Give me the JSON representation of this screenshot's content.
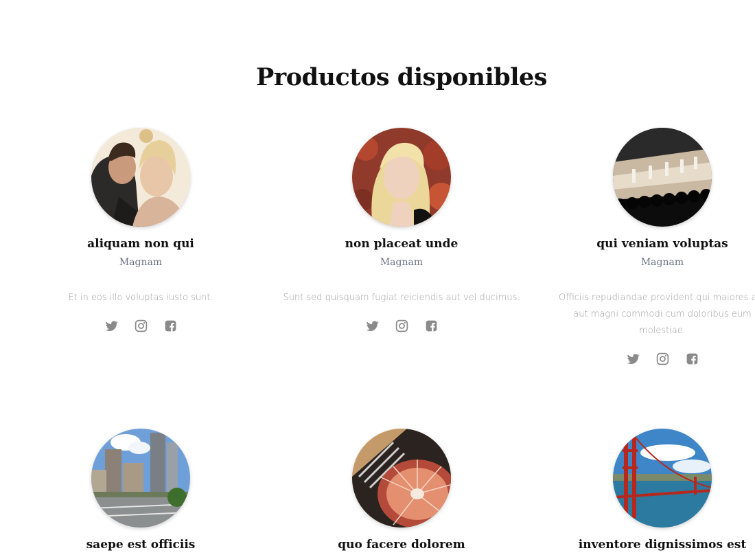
{
  "page": {
    "title": "Productos disponibles"
  },
  "products": [
    {
      "title": "aliquam non qui",
      "subtitle": "Magnam",
      "description": "Et in eos illo voluptas iusto sunt.",
      "image": "couple-photo"
    },
    {
      "title": "non placeat unde",
      "subtitle": "Magnam",
      "description": "Sunt sed quisquam fugiat reiciendis aut vel ducimus.",
      "image": "blonde-woman-photo"
    },
    {
      "title": "qui veniam voluptas",
      "subtitle": "Magnam",
      "description": "Officiis repudiandae provident qui maiores aut aut magni commodi cum doloribus eum molestiae.",
      "image": "runway-photo"
    },
    {
      "title": "saepe est officiis",
      "subtitle": "",
      "description": "",
      "image": "city-photo"
    },
    {
      "title": "quo facere dolorem",
      "subtitle": "",
      "description": "",
      "image": "turntable-photo"
    },
    {
      "title": "inventore dignissimos est",
      "subtitle": "",
      "description": "",
      "image": "golden-gate-photo"
    }
  ],
  "social_icons": [
    "twitter-icon",
    "instagram-icon",
    "facebook-icon"
  ],
  "colors": {
    "title": "#111111",
    "subtitle": "#6a7280",
    "description": "#9a9a9a",
    "icon": "#8a8a8a"
  }
}
